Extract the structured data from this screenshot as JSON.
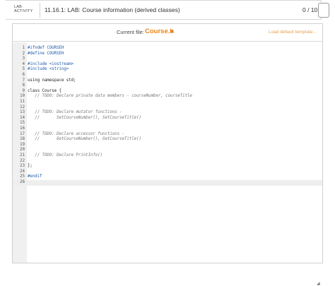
{
  "header": {
    "lab_label_line1": "LAB",
    "lab_label_line2": "ACTIVITY",
    "title": "11.16.1: LAB: Course information (derived classes)",
    "score": "0 / 10"
  },
  "toolbar": {
    "current_file_label": "Current file:",
    "file_name": "Course.h",
    "load_default_label": "Load default template..."
  },
  "editor": {
    "lines": [
      {
        "n": "1",
        "t": "#ifndef COURSEH"
      },
      {
        "n": "2",
        "t": "#define COURSEH"
      },
      {
        "n": "3",
        "t": ""
      },
      {
        "n": "4",
        "t": "#include <iostream>"
      },
      {
        "n": "5",
        "t": "#include <string>"
      },
      {
        "n": "6",
        "t": ""
      },
      {
        "n": "7",
        "t": "using namespace std;"
      },
      {
        "n": "8",
        "t": ""
      },
      {
        "n": "9",
        "t": "class Course {"
      },
      {
        "n": "10",
        "t": "   // TODO: Declare private data members - courseNumber, courseTitle"
      },
      {
        "n": "11",
        "t": ""
      },
      {
        "n": "12",
        "t": ""
      },
      {
        "n": "13",
        "t": "   // TODO: Declare mutator functions -"
      },
      {
        "n": "14",
        "t": "   //       SetCourseNumber(), SetCourseTitle()"
      },
      {
        "n": "15",
        "t": ""
      },
      {
        "n": "16",
        "t": ""
      },
      {
        "n": "17",
        "t": "   // TODO: Declare accessor functions -"
      },
      {
        "n": "18",
        "t": "   //       GetCourseNumber(), GetCourseTitle()"
      },
      {
        "n": "19",
        "t": ""
      },
      {
        "n": "20",
        "t": ""
      },
      {
        "n": "21",
        "t": "   // TODO: Declare PrintInfo()"
      },
      {
        "n": "22",
        "t": ""
      },
      {
        "n": "23",
        "t": "};"
      },
      {
        "n": "24",
        "t": ""
      },
      {
        "n": "25",
        "t": "#endif"
      },
      {
        "n": "26",
        "t": ""
      }
    ]
  },
  "colors": {
    "accent": "#e8841a",
    "line_number": "#555555",
    "comment": "#777777"
  }
}
